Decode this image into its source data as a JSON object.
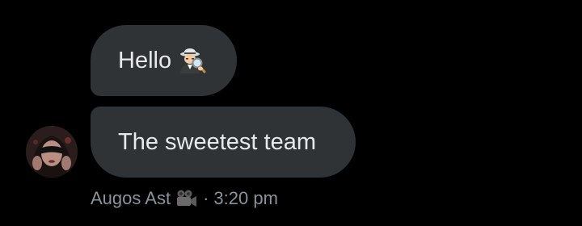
{
  "messages": [
    {
      "text": "Hello",
      "emoji": "detective-emoji"
    },
    {
      "text": "The sweetest team"
    }
  ],
  "sender": {
    "name": "Augos Ast",
    "name_icon": "movie-camera-emoji",
    "separator": "·",
    "time": "3:20 pm"
  },
  "colors": {
    "background": "#000000",
    "bubble": "#2f3336",
    "text": "#e7e9ea",
    "meta_text": "#8b9299"
  }
}
